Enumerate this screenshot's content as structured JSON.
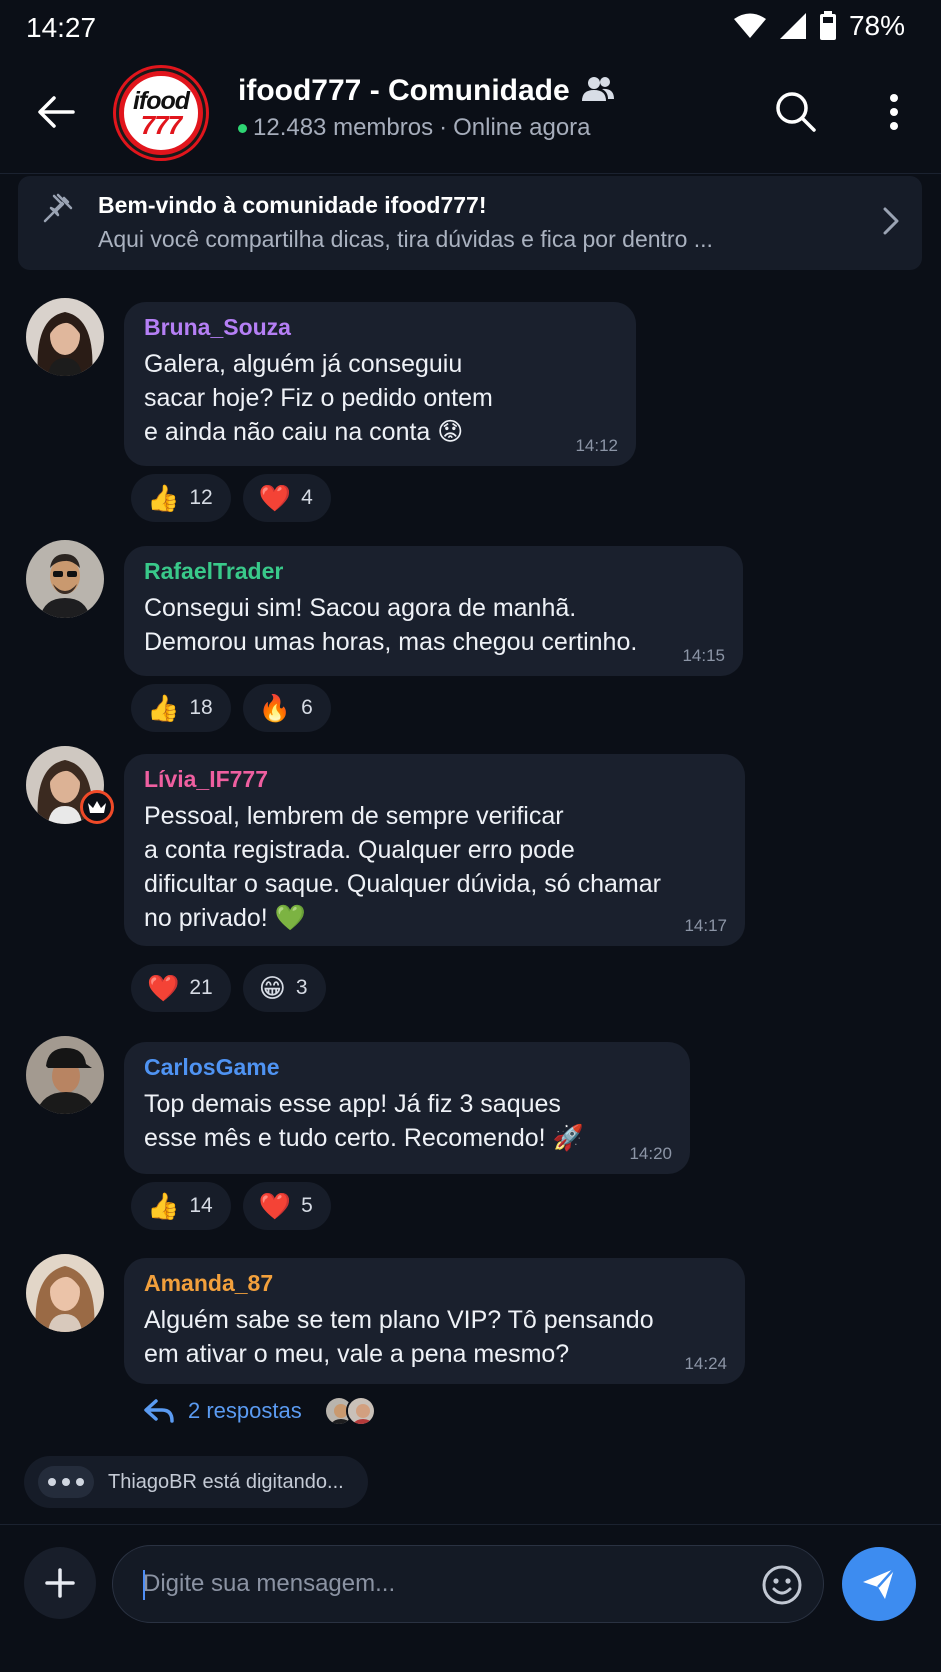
{
  "status_bar": {
    "time": "14:27",
    "battery": "78%"
  },
  "header": {
    "logo_top": "ifood",
    "logo_bottom": "777",
    "title": "ifood777 - Comunidade",
    "members": "12.483 membros",
    "separator": "·",
    "online": "Online agora"
  },
  "pinned": {
    "title": "Bem-vindo à comunidade ifood777!",
    "text": "Aqui você compartilha dicas, tira dúvidas e fica por dentro ..."
  },
  "messages": [
    {
      "sender": "Bruna_Souza",
      "sender_color": "#b57ff5",
      "text": "Galera, alguém já conseguiu\nsacar hoje? Fiz o pedido ontem\ne ainda não caiu na conta 😟",
      "time": "14:12",
      "reactions": [
        {
          "emoji": "👍",
          "count": "12"
        },
        {
          "emoji": "❤️",
          "count": "4"
        }
      ]
    },
    {
      "sender": "RafaelTrader",
      "sender_color": "#39c98a",
      "text": "Consegui sim! Sacou agora de manhã.\nDemorou umas horas, mas chegou certinho.",
      "time": "14:15",
      "reactions": [
        {
          "emoji": "👍",
          "count": "18"
        },
        {
          "emoji": "🔥",
          "count": "6"
        }
      ]
    },
    {
      "sender": "Lívia_IF777",
      "sender_color": "#ef5fa0",
      "text": "Pessoal, lembrem de sempre verificar\na conta registrada. Qualquer erro pode\ndificultar o saque. Qualquer dúvida, só chamar\nno privado! 💚",
      "time": "14:17",
      "reactions": [
        {
          "emoji": "❤️",
          "count": "21"
        },
        {
          "emoji": "😁",
          "count": "3"
        }
      ]
    },
    {
      "sender": "CarlosGame",
      "sender_color": "#4f93f2",
      "text": "Top demais esse app! Já fiz 3 saques\nesse mês e tudo certo. Recomendo! 🚀",
      "time": "14:20",
      "reactions": [
        {
          "emoji": "👍",
          "count": "14"
        },
        {
          "emoji": "❤️",
          "count": "5"
        }
      ]
    },
    {
      "sender": "Amanda_87",
      "sender_color": "#f2a03c",
      "text": "Alguém sabe se tem plano VIP? Tô pensando\nem ativar o meu, vale a pena mesmo?",
      "time": "14:24",
      "reactions": []
    }
  ],
  "replies": {
    "label": "2 respostas"
  },
  "typing": {
    "text": "ThiagoBR está digitando..."
  },
  "composer": {
    "placeholder": "Digite sua mensagem..."
  }
}
